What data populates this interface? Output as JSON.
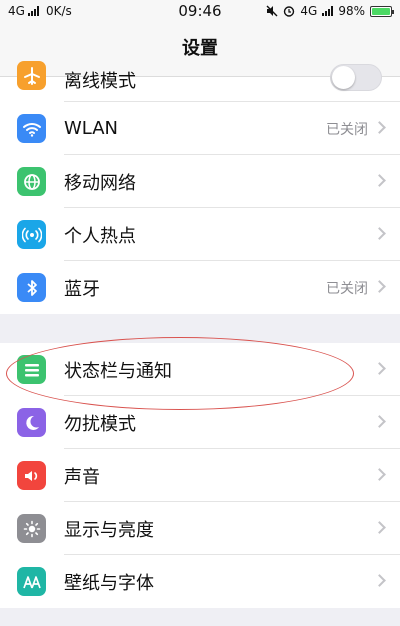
{
  "status_bar": {
    "network_left": "4G",
    "speed": "0K/s",
    "time": "09:46",
    "network_right": "4G",
    "battery": "98%",
    "battery_level": 0.98
  },
  "nav": {
    "title": "设置"
  },
  "group1": [
    {
      "label": "离线模式",
      "icon": "airplane-icon",
      "color": "#f7a02d",
      "control": "toggle",
      "toggle_on": false
    },
    {
      "label": "WLAN",
      "icon": "wifi-icon",
      "color": "#3a8af6",
      "value": "已关闭"
    },
    {
      "label": "移动网络",
      "icon": "globe-icon",
      "color": "#3cc36f"
    },
    {
      "label": "个人热点",
      "icon": "hotspot-icon",
      "color": "#1aa6e8"
    },
    {
      "label": "蓝牙",
      "icon": "bluetooth-icon",
      "color": "#3a8af6",
      "value": "已关闭"
    }
  ],
  "group2": [
    {
      "label": "状态栏与通知",
      "icon": "statusbar-icon",
      "color": "#3cc36f"
    },
    {
      "label": "勿扰模式",
      "icon": "moon-icon",
      "color": "#8b63e6"
    },
    {
      "label": "声音",
      "icon": "speaker-icon",
      "color": "#f2453d"
    },
    {
      "label": "显示与亮度",
      "icon": "brightness-icon",
      "color": "#8e8e93"
    },
    {
      "label": "壁纸与字体",
      "icon": "wallpaper-font-icon",
      "color": "#1fb6a5"
    }
  ]
}
